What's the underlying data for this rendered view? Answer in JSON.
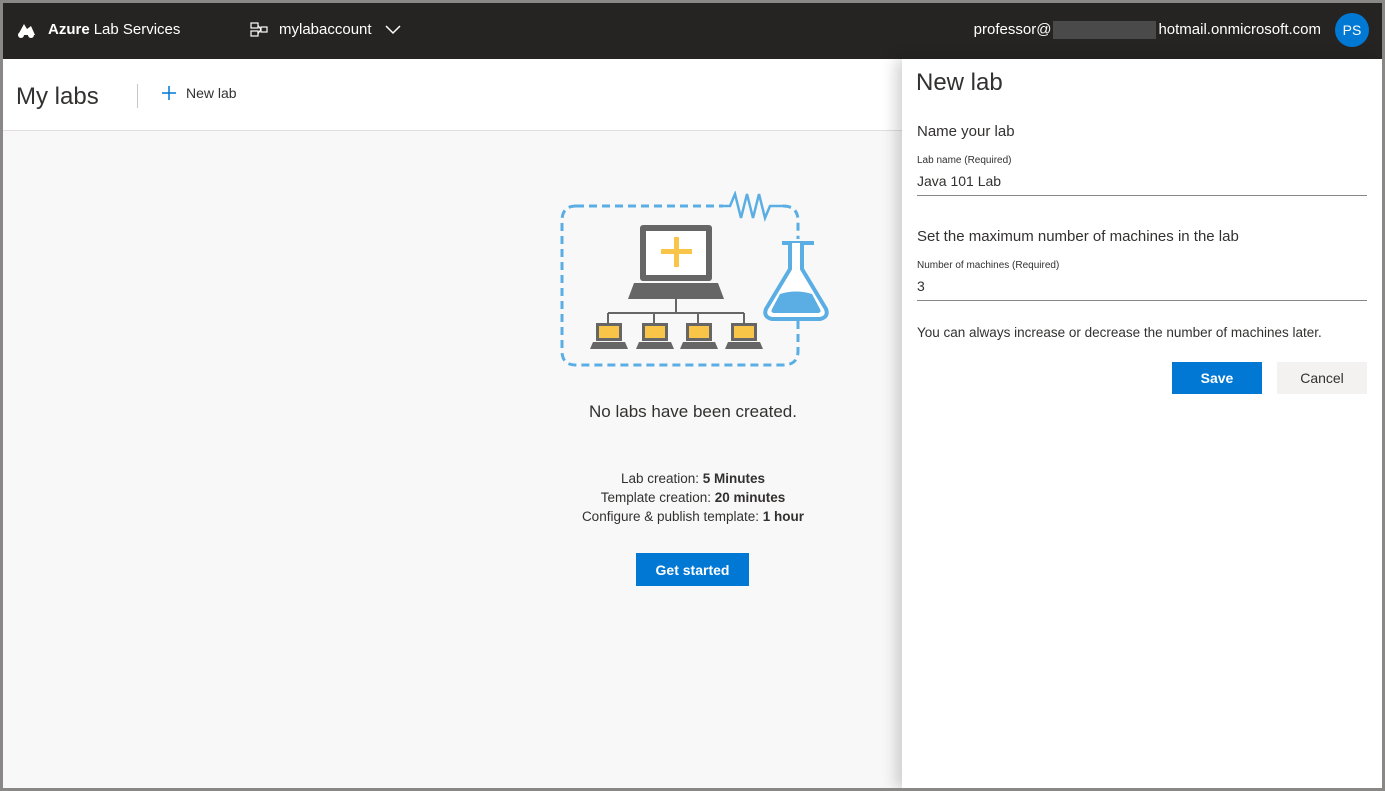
{
  "topbar": {
    "brand_bold": "Azure",
    "brand_rest": "Lab Services",
    "account_name": "mylabaccount",
    "email_prefix": "professor@",
    "email_suffix": "hotmail.onmicrosoft.com",
    "avatar_initials": "PS",
    "icons": [
      "azure-logo-icon",
      "lab-account-icon",
      "chevron-down-icon"
    ]
  },
  "header": {
    "title": "My labs",
    "new_lab_label": "New lab"
  },
  "main": {
    "empty_message": "No labs have been created.",
    "stats": [
      {
        "label": "Lab creation: ",
        "value": "5 Minutes"
      },
      {
        "label": "Template creation: ",
        "value": "20 minutes"
      },
      {
        "label": "Configure & publish template: ",
        "value": "1 hour"
      }
    ],
    "get_started_label": "Get started"
  },
  "panel": {
    "title": "New lab",
    "section_name": "Name your lab",
    "lab_name_label": "Lab name (Required)",
    "lab_name_value": "Java 101 Lab",
    "section_machines": "Set the maximum number of machines in the lab",
    "machines_label": "Number of machines (Required)",
    "machines_value": "3",
    "hint": "You can always increase or decrease the number of machines later.",
    "save_label": "Save",
    "cancel_label": "Cancel"
  },
  "colors": {
    "topbar_bg": "#252423",
    "accent": "#0078d4",
    "illustration_blue": "#5aaee3",
    "illustration_yellow": "#f8c548",
    "illustration_gray": "#666666"
  }
}
